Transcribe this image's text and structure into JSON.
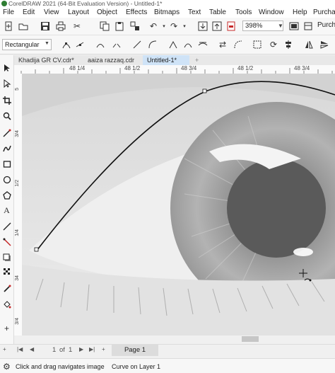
{
  "window": {
    "title": "CorelDRAW 2021 (64-Bit Evaluation Version) - Untitled-1*"
  },
  "menu": [
    "File",
    "Edit",
    "View",
    "Layout",
    "Object",
    "Effects",
    "Bitmaps",
    "Text",
    "Table",
    "Tools",
    "Window",
    "Help",
    "Purcha"
  ],
  "toolbar": {
    "icons": [
      "new-icon",
      "open-icon",
      "save-icon",
      "print-icon",
      "cut-icon",
      "copy-icon",
      "paste-icon",
      "undo-icon",
      "redo-icon",
      "search-icon",
      "import-icon",
      "export-icon",
      "export-pdf-icon",
      "publish-icon"
    ],
    "zoom": "398%",
    "purchase_label": "Purchas"
  },
  "property_bar": {
    "shape_mode": "Rectangular"
  },
  "document_tabs": [
    {
      "label": "Khadija GR CV.cdr*",
      "active": false
    },
    {
      "label": "aaiza razzaq.cdr",
      "active": false
    },
    {
      "label": "Untitled-1*",
      "active": true
    }
  ],
  "add_tab_label": "+",
  "ruler": {
    "horizontal_labels": [
      "48 1/4",
      "48 1/2",
      "48 3/4",
      "48 1/2",
      "48 3/4"
    ],
    "vertical_labels": [
      "5",
      "3/4",
      "1/2",
      "1/4",
      "34",
      "3/4"
    ]
  },
  "page_navigator": {
    "current": "1",
    "of_label": "of",
    "total": "1",
    "page_tab": "Page 1"
  },
  "status": {
    "hint": "Click and drag navigates image",
    "selection": "Curve on Layer 1"
  },
  "colors": {
    "accent": "#1e73be",
    "active_tab": "#cfe3f7",
    "curve": "#111111"
  },
  "canvas": {
    "content": "grayscale eye photo with selected curve"
  }
}
